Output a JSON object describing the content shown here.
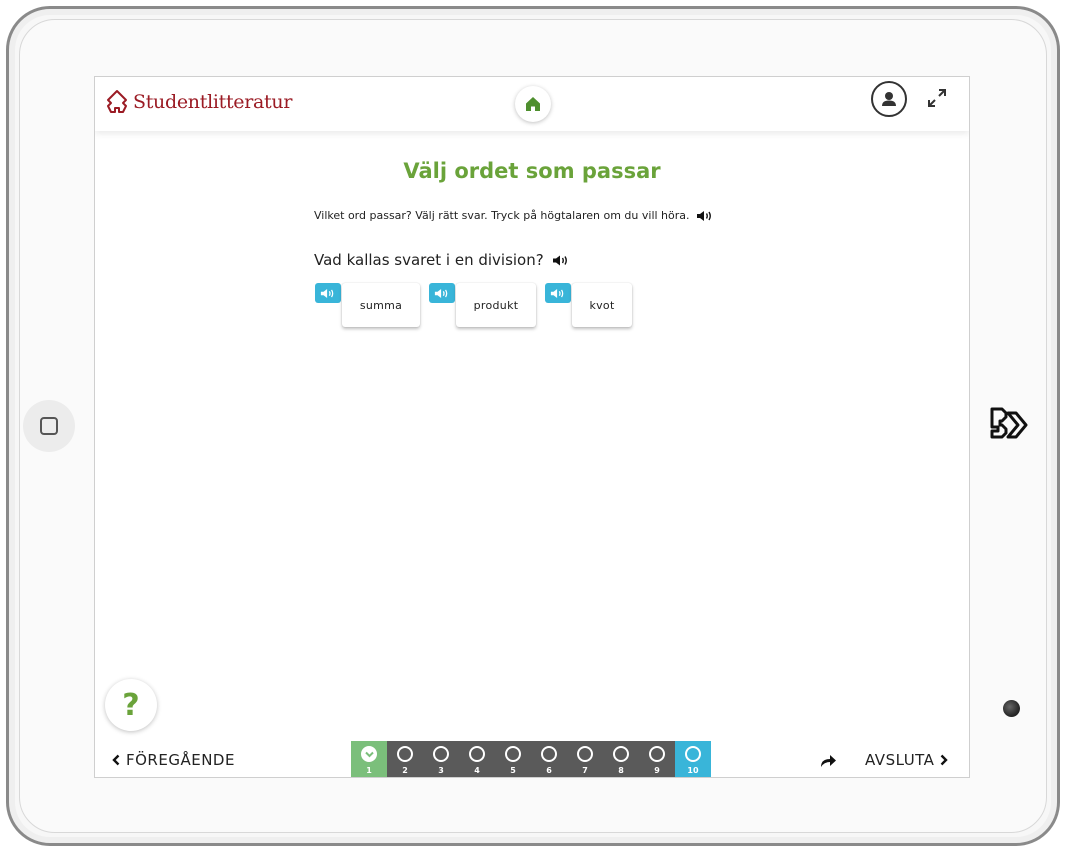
{
  "brand": {
    "name": "Studentlitteratur",
    "color": "#9b1b24"
  },
  "colors": {
    "accent_green": "#6aa33a",
    "speaker_blue": "#39b5d9",
    "progress_done": "#7bbf7b",
    "progress_pending": "#5a5a5a"
  },
  "header": {
    "home_icon": "house-icon",
    "user_icon": "user-icon",
    "expand_icon": "expand-icon"
  },
  "exercise": {
    "title": "Välj ordet som passar",
    "instruction": "Vilket ord passar? Välj rätt svar. Tryck på högtalaren om du vill höra.",
    "question": "Vad kallas svaret i en division?",
    "options": [
      {
        "label": "summa"
      },
      {
        "label": "produkt"
      },
      {
        "label": "kvot"
      }
    ]
  },
  "help": {
    "label": "?"
  },
  "footer": {
    "prev_label": "FÖREGÅENDE",
    "next_label": "AVSLUTA",
    "steps": [
      {
        "num": "1",
        "state": "done"
      },
      {
        "num": "2",
        "state": "pending"
      },
      {
        "num": "3",
        "state": "pending"
      },
      {
        "num": "4",
        "state": "pending"
      },
      {
        "num": "5",
        "state": "pending"
      },
      {
        "num": "6",
        "state": "pending"
      },
      {
        "num": "7",
        "state": "pending"
      },
      {
        "num": "8",
        "state": "pending"
      },
      {
        "num": "9",
        "state": "pending"
      },
      {
        "num": "10",
        "state": "current"
      }
    ]
  }
}
